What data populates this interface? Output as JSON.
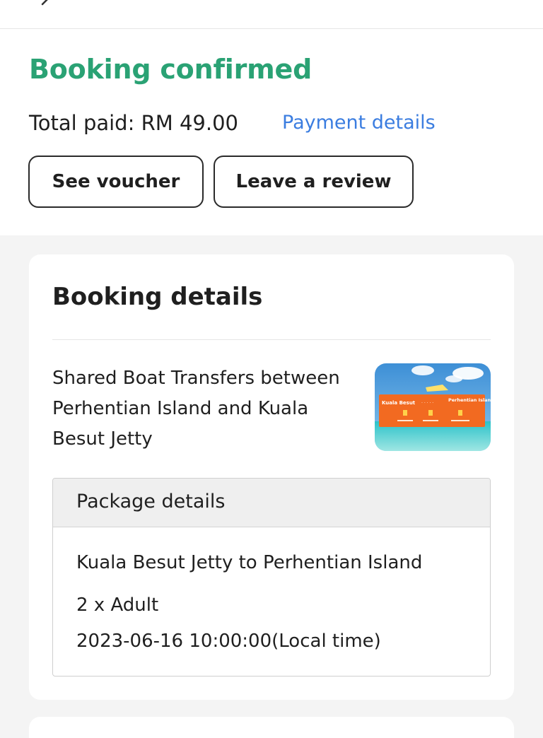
{
  "header": {
    "title": "Booking confirmed",
    "total_paid": "Total paid: RM 49.00",
    "payment_link": "Payment details",
    "see_voucher": "See voucher",
    "leave_review": "Leave a review"
  },
  "booking": {
    "section_title": "Booking details",
    "product_name": "Shared Boat Transfers between Perhentian Island and Kuala Besut Jetty",
    "thumbnail": {
      "from_label": "Kuala Besut",
      "to_label": "Perhentian Island"
    },
    "package": {
      "header": "Package details",
      "route": "Kuala Besut Jetty to Perhentian Island",
      "quantity": "2 x Adult",
      "datetime": "2023-06-16 10:00:00(Local time)"
    }
  },
  "colors": {
    "title_green": "#2aa274",
    "link_blue": "#3b7de0",
    "thumbnail_orange": "#f26a21"
  },
  "icons": {
    "back": "chevron-left-icon"
  }
}
